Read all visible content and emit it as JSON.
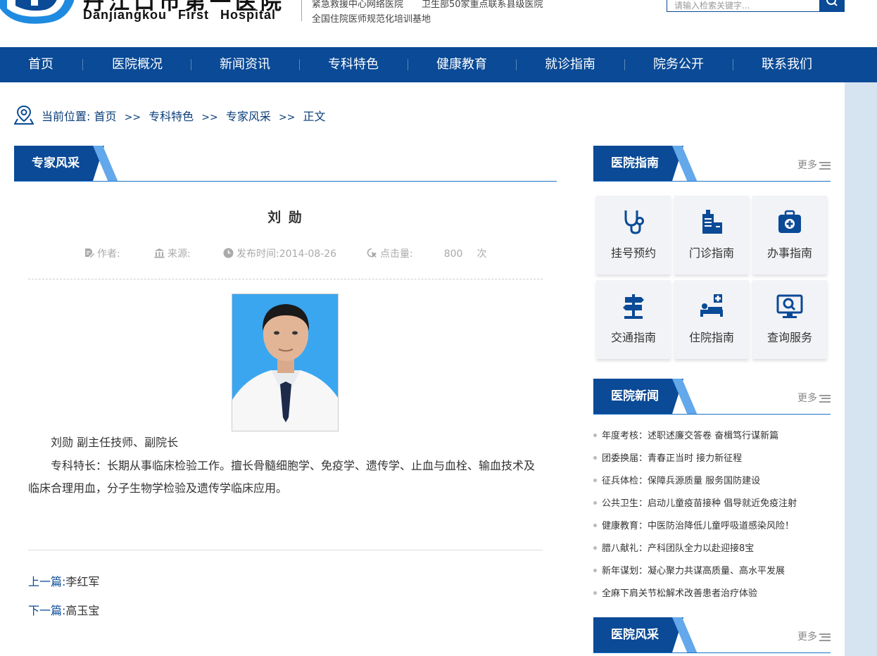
{
  "header": {
    "logo_cn": "丹江口市第一医院",
    "logo_en": "Danjiangkou First Hospital",
    "tag_line1_a": "紧急救援中心网络医院",
    "tag_line1_b": "卫生部50家重点联系县级医院",
    "tag_line2": "全国住院医师规范化培训基地",
    "search_placeholder": "请输入检索关键字..."
  },
  "nav": {
    "items": [
      "首页",
      "医院概况",
      "新闻资讯",
      "专科特色",
      "健康教育",
      "就诊指南",
      "院务公开",
      "联系我们"
    ]
  },
  "breadcrumb": {
    "label": "当前位置:",
    "items": [
      "首页",
      "专科特色",
      "专家风采",
      "正文"
    ],
    "separator": ">>"
  },
  "main": {
    "section_title": "专家风采",
    "article": {
      "title": "刘 勋",
      "author_label": "作者:",
      "source_label": "来源:",
      "date_label": "发布时间:",
      "date": "2014-08-26",
      "clicks_label": "点击量:",
      "clicks": "800",
      "clicks_unit": "次",
      "para1": "刘勋  副主任技师、副院长",
      "para2_line1": "专科特长：长期从事临床检验工作。擅长骨髓细胞学、免疫学、遗传学、止血与血栓、输血技术及",
      "para2_line2": "临床合理用血，分子生物学检验及遗传学临床应用。"
    },
    "prev_label": "上一篇:",
    "prev_title": "李红军",
    "next_label": "下一篇:",
    "next_title": "高玉宝"
  },
  "sidebar": {
    "guide": {
      "title": "医院指南",
      "more": "更多",
      "items": [
        {
          "label": "挂号预约",
          "icon": "stethoscope-icon"
        },
        {
          "label": "门诊指南",
          "icon": "clinic-building-icon"
        },
        {
          "label": "办事指南",
          "icon": "medical-kit-icon"
        },
        {
          "label": "交通指南",
          "icon": "signpost-icon"
        },
        {
          "label": "住院指南",
          "icon": "hospital-bed-icon"
        },
        {
          "label": "查询服务",
          "icon": "search-monitor-icon"
        }
      ]
    },
    "news": {
      "title": "医院新闻",
      "more": "更多",
      "items": [
        "年度考核：述职述廉交答卷 奋楫笃行谋新篇",
        "团委换届：青春正当时 接力新征程",
        "征兵体检：保障兵源质量 服务国防建设",
        "公共卫生：启动儿童疫苗接种 倡导就近免疫注射",
        "健康教育：中医防治降低儿童呼吸道感染风险！",
        "腊八献礼：产科团队全力以赴迎接8宝",
        "新年谋划：凝心聚力共谋高质量、高水平发展",
        "全麻下肩关节松解术改善患者治疗体验"
      ]
    },
    "style": {
      "title": "医院风采",
      "more": "更多"
    }
  },
  "colors": {
    "primary": "#0a4a96",
    "accent": "#62a8ea",
    "band": "#d6e4f2"
  }
}
